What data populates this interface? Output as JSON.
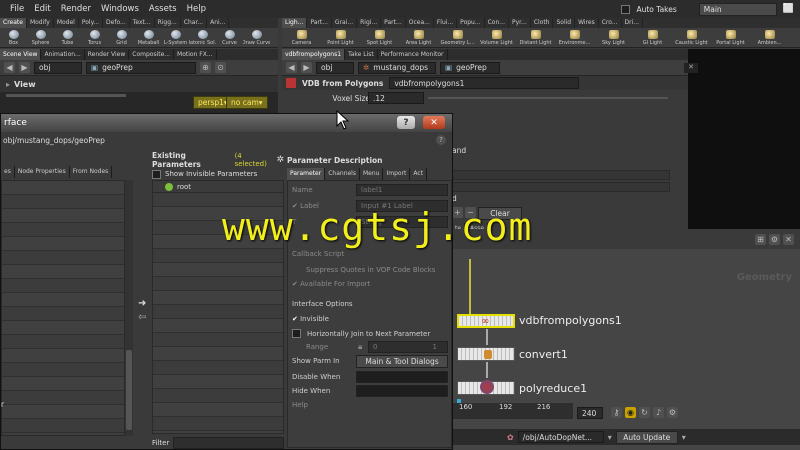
{
  "menubar": {
    "items": [
      "File",
      "Edit",
      "Render",
      "Windows",
      "Assets",
      "Help"
    ],
    "auto_takes_label": "Auto Takes",
    "desktop_value": "Main"
  },
  "left_shelf": {
    "tabs": [
      "Create",
      "Modify",
      "Model",
      "Poly...",
      "Defo...",
      "Text...",
      "Rigg...",
      "Char...",
      "Ani..."
    ],
    "tools": [
      "Box",
      "Sphere",
      "Tube",
      "Torus",
      "Grid",
      "Metaball",
      "L-System",
      "Platonic Sol...",
      "Curve",
      "Draw Curve"
    ]
  },
  "right_shelf": {
    "tabs": [
      "Ligh...",
      "Part...",
      "Grai...",
      "Rigi...",
      "Part...",
      "Ocea...",
      "Flui...",
      "Popu...",
      "Con...",
      "Pyr...",
      "Cloth",
      "Solid",
      "Wires",
      "Cro...",
      "Dri..."
    ],
    "tools": [
      "Camera",
      "Point Light",
      "Spot Light",
      "Area Light",
      "Geometry L...",
      "Volume Light",
      "Distant Light",
      "Environme...",
      "Sky Light",
      "GI Light",
      "Caustic Light",
      "Portal Light",
      "Ambien..."
    ]
  },
  "viewport_panel": {
    "tabs": [
      "Scene View",
      "Animation...",
      "Render View",
      "Composite...",
      "Motion FX..."
    ],
    "path_root": "obj",
    "path_node": "geoPrep",
    "view_label": "View",
    "persp": "persp1",
    "cam": "no cam"
  },
  "param_panel": {
    "tabs": [
      "vdbfrompolygons1",
      "Take List",
      "Performance Monitor"
    ],
    "path_root": "obj",
    "path_mid": "mustang_dops",
    "path_node": "geoPrep",
    "node_type": "VDB from Polygons",
    "node_name": "vdbfrompolygons1",
    "voxel_label": "Voxel Size",
    "voxel_value": ".12",
    "partial_and": "and",
    "partial_d": "d",
    "clear_label": "Clear",
    "assets_tab": "Asse",
    "tab_fragment": "te"
  },
  "network": {
    "context_label": "Geometry",
    "nodes": [
      {
        "name": "vdbfrompolygons1"
      },
      {
        "name": "convert1"
      },
      {
        "name": "polyreduce1"
      }
    ],
    "ruler": [
      "160",
      "192",
      "216"
    ],
    "frame_value": "240",
    "status_path": "/obj/AutoDopNet...",
    "update_mode": "Auto Update"
  },
  "dialog": {
    "title_fragment": "rface",
    "path": "obj/mustang_dops/geoPrep",
    "left_tabs": [
      "es",
      "Node Properties",
      "From Nodes"
    ],
    "left_r_fragment": "r",
    "existing_title": "Existing Parameters",
    "selected_count": "(4 selected)",
    "show_invisible": "Show Invisible Parameters",
    "root_label": "root",
    "filter_label": "Filter",
    "desc_title": "Parameter Description",
    "desc_tabs": [
      "Parameter",
      "Channels",
      "Menu",
      "Import",
      "Act"
    ],
    "name_label": "Name",
    "name_value": "label1",
    "label_label": "Label",
    "label_value": "Input #1 Label",
    "type_fragment": "T",
    "type_value": "String",
    "callback_label": "Callback Script",
    "suppress_label": "Suppress Quotes in VOP Code Blocks",
    "available_label": "Available For Import",
    "interface_options": "Interface Options",
    "invisible_label": "Invisible",
    "horiz_join_label": "Horizontally Join to Next Parameter",
    "range_label": "Range",
    "range_min": "0",
    "range_max": "1",
    "show_parm_label": "Show Parm In",
    "show_parm_value": "Main & Tool Dialogs",
    "disable_when_label": "Disable When",
    "hide_when_label": "Hide When",
    "help_label": "Help"
  },
  "watermark": "www.cgtsj.com",
  "colors": {
    "accent_yellow": "#f2ef1c",
    "selected_count": "#d9d531",
    "node_red": "#c0392b"
  }
}
